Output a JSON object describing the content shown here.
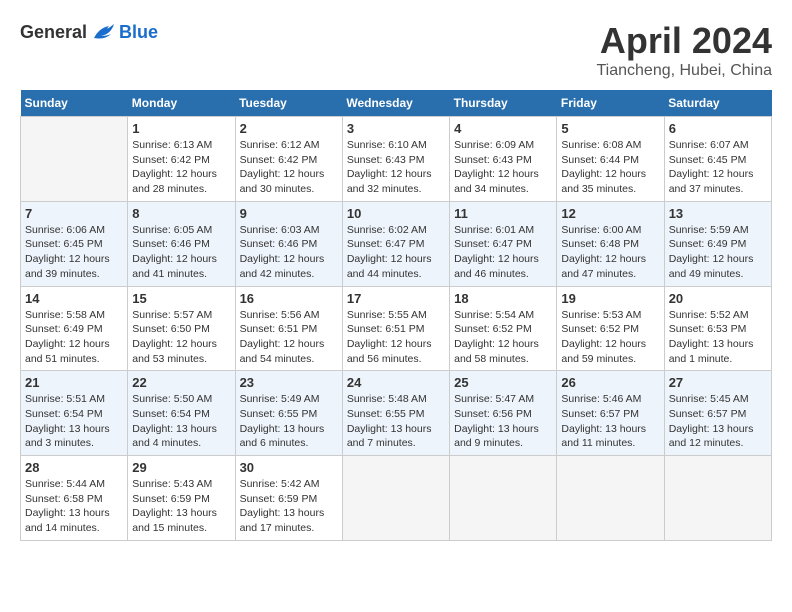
{
  "header": {
    "logo_general": "General",
    "logo_blue": "Blue",
    "title": "April 2024",
    "subtitle": "Tiancheng, Hubei, China"
  },
  "calendar": {
    "weekdays": [
      "Sunday",
      "Monday",
      "Tuesday",
      "Wednesday",
      "Thursday",
      "Friday",
      "Saturday"
    ],
    "weeks": [
      [
        {
          "day": "",
          "info": ""
        },
        {
          "day": "1",
          "info": "Sunrise: 6:13 AM\nSunset: 6:42 PM\nDaylight: 12 hours\nand 28 minutes."
        },
        {
          "day": "2",
          "info": "Sunrise: 6:12 AM\nSunset: 6:42 PM\nDaylight: 12 hours\nand 30 minutes."
        },
        {
          "day": "3",
          "info": "Sunrise: 6:10 AM\nSunset: 6:43 PM\nDaylight: 12 hours\nand 32 minutes."
        },
        {
          "day": "4",
          "info": "Sunrise: 6:09 AM\nSunset: 6:43 PM\nDaylight: 12 hours\nand 34 minutes."
        },
        {
          "day": "5",
          "info": "Sunrise: 6:08 AM\nSunset: 6:44 PM\nDaylight: 12 hours\nand 35 minutes."
        },
        {
          "day": "6",
          "info": "Sunrise: 6:07 AM\nSunset: 6:45 PM\nDaylight: 12 hours\nand 37 minutes."
        }
      ],
      [
        {
          "day": "7",
          "info": "Sunrise: 6:06 AM\nSunset: 6:45 PM\nDaylight: 12 hours\nand 39 minutes."
        },
        {
          "day": "8",
          "info": "Sunrise: 6:05 AM\nSunset: 6:46 PM\nDaylight: 12 hours\nand 41 minutes."
        },
        {
          "day": "9",
          "info": "Sunrise: 6:03 AM\nSunset: 6:46 PM\nDaylight: 12 hours\nand 42 minutes."
        },
        {
          "day": "10",
          "info": "Sunrise: 6:02 AM\nSunset: 6:47 PM\nDaylight: 12 hours\nand 44 minutes."
        },
        {
          "day": "11",
          "info": "Sunrise: 6:01 AM\nSunset: 6:47 PM\nDaylight: 12 hours\nand 46 minutes."
        },
        {
          "day": "12",
          "info": "Sunrise: 6:00 AM\nSunset: 6:48 PM\nDaylight: 12 hours\nand 47 minutes."
        },
        {
          "day": "13",
          "info": "Sunrise: 5:59 AM\nSunset: 6:49 PM\nDaylight: 12 hours\nand 49 minutes."
        }
      ],
      [
        {
          "day": "14",
          "info": "Sunrise: 5:58 AM\nSunset: 6:49 PM\nDaylight: 12 hours\nand 51 minutes."
        },
        {
          "day": "15",
          "info": "Sunrise: 5:57 AM\nSunset: 6:50 PM\nDaylight: 12 hours\nand 53 minutes."
        },
        {
          "day": "16",
          "info": "Sunrise: 5:56 AM\nSunset: 6:51 PM\nDaylight: 12 hours\nand 54 minutes."
        },
        {
          "day": "17",
          "info": "Sunrise: 5:55 AM\nSunset: 6:51 PM\nDaylight: 12 hours\nand 56 minutes."
        },
        {
          "day": "18",
          "info": "Sunrise: 5:54 AM\nSunset: 6:52 PM\nDaylight: 12 hours\nand 58 minutes."
        },
        {
          "day": "19",
          "info": "Sunrise: 5:53 AM\nSunset: 6:52 PM\nDaylight: 12 hours\nand 59 minutes."
        },
        {
          "day": "20",
          "info": "Sunrise: 5:52 AM\nSunset: 6:53 PM\nDaylight: 13 hours\nand 1 minute."
        }
      ],
      [
        {
          "day": "21",
          "info": "Sunrise: 5:51 AM\nSunset: 6:54 PM\nDaylight: 13 hours\nand 3 minutes."
        },
        {
          "day": "22",
          "info": "Sunrise: 5:50 AM\nSunset: 6:54 PM\nDaylight: 13 hours\nand 4 minutes."
        },
        {
          "day": "23",
          "info": "Sunrise: 5:49 AM\nSunset: 6:55 PM\nDaylight: 13 hours\nand 6 minutes."
        },
        {
          "day": "24",
          "info": "Sunrise: 5:48 AM\nSunset: 6:55 PM\nDaylight: 13 hours\nand 7 minutes."
        },
        {
          "day": "25",
          "info": "Sunrise: 5:47 AM\nSunset: 6:56 PM\nDaylight: 13 hours\nand 9 minutes."
        },
        {
          "day": "26",
          "info": "Sunrise: 5:46 AM\nSunset: 6:57 PM\nDaylight: 13 hours\nand 11 minutes."
        },
        {
          "day": "27",
          "info": "Sunrise: 5:45 AM\nSunset: 6:57 PM\nDaylight: 13 hours\nand 12 minutes."
        }
      ],
      [
        {
          "day": "28",
          "info": "Sunrise: 5:44 AM\nSunset: 6:58 PM\nDaylight: 13 hours\nand 14 minutes."
        },
        {
          "day": "29",
          "info": "Sunrise: 5:43 AM\nSunset: 6:59 PM\nDaylight: 13 hours\nand 15 minutes."
        },
        {
          "day": "30",
          "info": "Sunrise: 5:42 AM\nSunset: 6:59 PM\nDaylight: 13 hours\nand 17 minutes."
        },
        {
          "day": "",
          "info": ""
        },
        {
          "day": "",
          "info": ""
        },
        {
          "day": "",
          "info": ""
        },
        {
          "day": "",
          "info": ""
        }
      ]
    ]
  }
}
